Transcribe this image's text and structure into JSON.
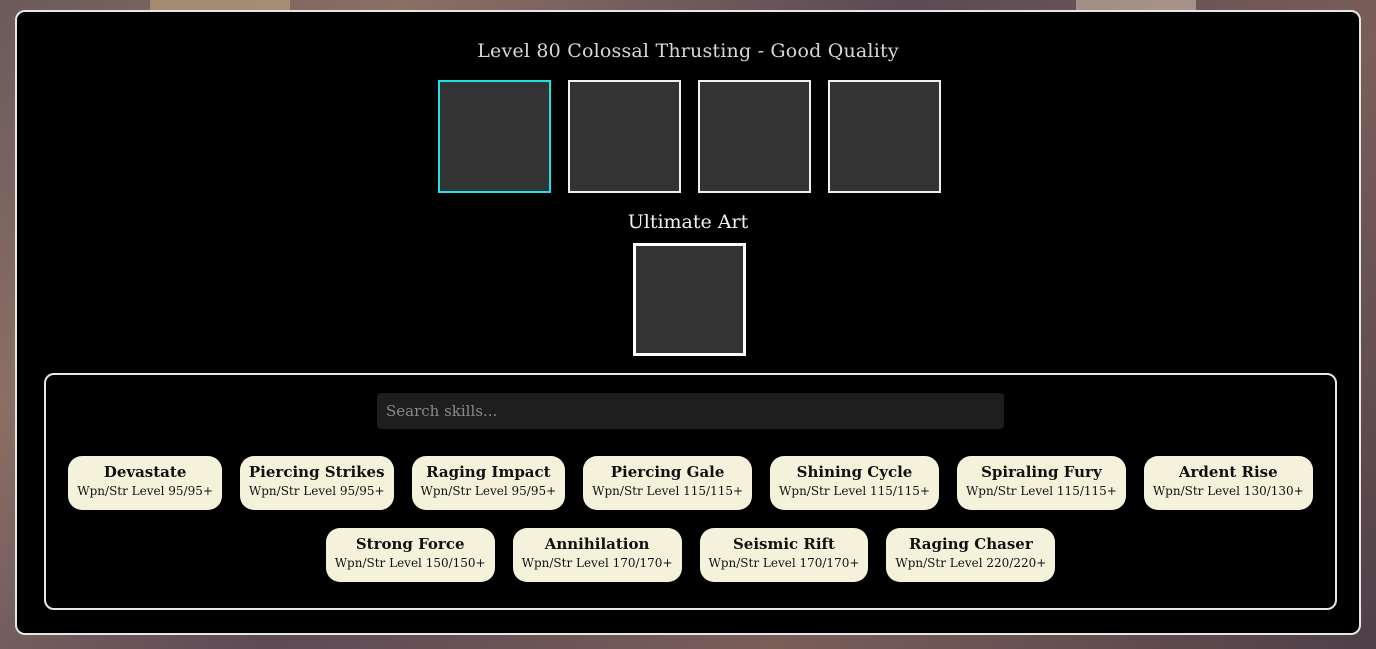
{
  "header": {
    "title": "Level 80 Colossal Thrusting - Good Quality"
  },
  "ultimate": {
    "label": "Ultimate Art"
  },
  "search": {
    "placeholder": "Search skills..."
  },
  "skills_row1": [
    {
      "name": "Devastate",
      "req": "Wpn/Str Level 95/95+"
    },
    {
      "name": "Piercing Strikes",
      "req": "Wpn/Str Level 95/95+"
    },
    {
      "name": "Raging Impact",
      "req": "Wpn/Str Level 95/95+"
    },
    {
      "name": "Piercing Gale",
      "req": "Wpn/Str Level 115/115+"
    },
    {
      "name": "Shining Cycle",
      "req": "Wpn/Str Level 115/115+"
    },
    {
      "name": "Spiraling Fury",
      "req": "Wpn/Str Level 115/115+"
    },
    {
      "name": "Ardent Rise",
      "req": "Wpn/Str Level 130/130+"
    }
  ],
  "skills_row2": [
    {
      "name": "Strong Force",
      "req": "Wpn/Str Level 150/150+"
    },
    {
      "name": "Annihilation",
      "req": "Wpn/Str Level 170/170+"
    },
    {
      "name": "Seismic Rift",
      "req": "Wpn/Str Level 170/170+"
    },
    {
      "name": "Raging Chaser",
      "req": "Wpn/Str Level 220/220+"
    }
  ],
  "colors": {
    "active_slot_border": "#1ee0e8",
    "chip_background": "#f5f2dc",
    "slot_fill": "#333333"
  }
}
